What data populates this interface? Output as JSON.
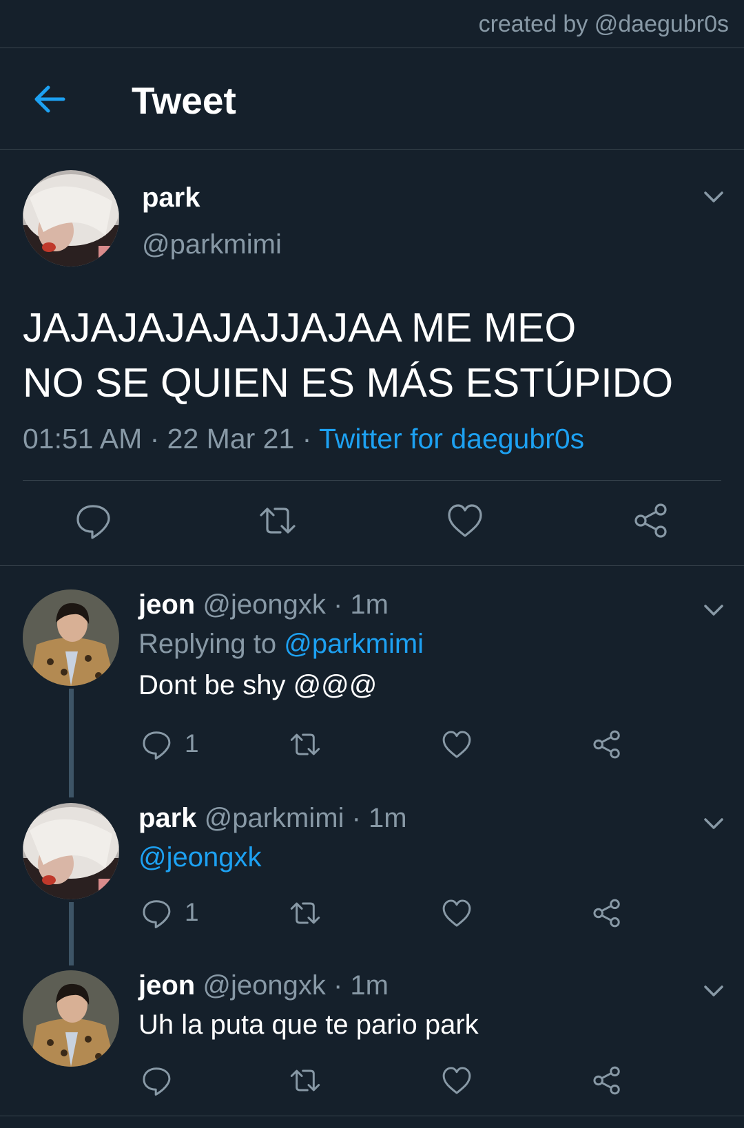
{
  "credit": "created by @daegubr0s",
  "header": {
    "title": "Tweet",
    "back_icon": "arrow-left-icon"
  },
  "colors": {
    "background": "#15202b",
    "accent": "#1da1f2",
    "muted": "#8899a6",
    "border": "#38444d"
  },
  "main_tweet": {
    "name": "park",
    "handle": "@parkmimi",
    "text_line1": "JAJAJAJAJAJJAJAA ME MEO",
    "text_line2": "NO SE QUIEN ES MÁS ESTÚPIDO",
    "time": "01:51 AM",
    "sep1": " · ",
    "date": "22 Mar 21",
    "sep2": " · ",
    "source": "Twitter for daegubr0s"
  },
  "replies": [
    {
      "name": "jeon",
      "handle": "@jeongxk",
      "sep": " · ",
      "time": "1m",
      "replying_prefix": "Replying to ",
      "replying_to": "@parkmimi",
      "text": "Dont be shy @@@",
      "reply_count": "1"
    },
    {
      "name": "park",
      "handle": "@parkmimi",
      "sep": " · ",
      "time": "1m",
      "mention": "@jeongxk",
      "reply_count": "1"
    },
    {
      "name": "jeon",
      "handle": "@jeongxk",
      "sep": " · ",
      "time": "1m",
      "text": "Uh la puta que te pario park"
    }
  ]
}
